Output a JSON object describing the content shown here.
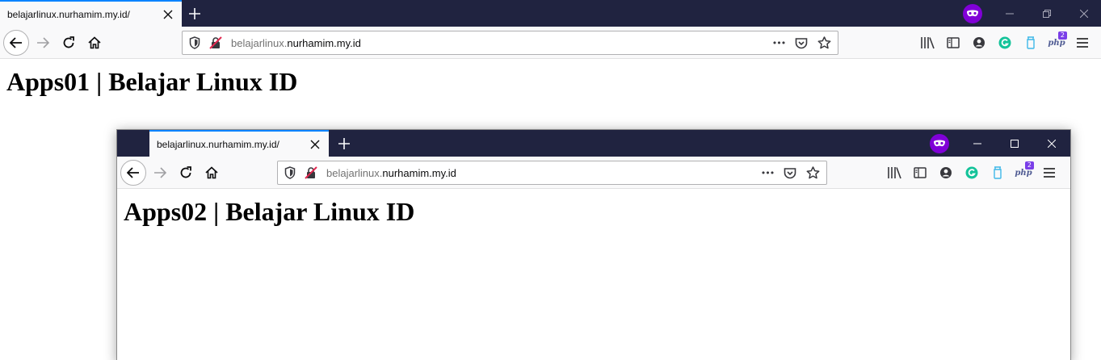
{
  "window1": {
    "tab_title": "belajarlinux.nurhamim.my.id/",
    "url_subdomain": "belajarlinux.",
    "url_domain": "nurhamim.my.id",
    "url_more": "•••",
    "php_badge": "2",
    "heading": "Apps01 | Belajar Linux ID"
  },
  "window2": {
    "tab_title": "belajarlinux.nurhamim.my.id/",
    "url_subdomain": "belajarlinux.",
    "url_domain": "nurhamim.my.id",
    "url_more": "•••",
    "php_badge": "2",
    "heading": "Apps02 | Belajar Linux ID"
  },
  "colors": {
    "tabbar_bg": "#202340",
    "active_tab_accent": "#0a84ff",
    "private_icon": "#8000d7",
    "grammarly": "#15c39a",
    "php_badge": "#7a3ee8"
  },
  "icons": [
    "close-icon",
    "plus-icon",
    "private-mask-icon",
    "minimize-icon",
    "maximize-icon",
    "back-arrow-icon",
    "forward-arrow-icon",
    "reload-icon",
    "home-icon",
    "shield-icon",
    "insecure-lock-icon",
    "page-actions-icon",
    "pocket-icon",
    "star-icon",
    "library-icon",
    "sidebar-icon",
    "account-icon",
    "grammarly-icon",
    "extension-icon",
    "php-icon",
    "menu-icon"
  ]
}
